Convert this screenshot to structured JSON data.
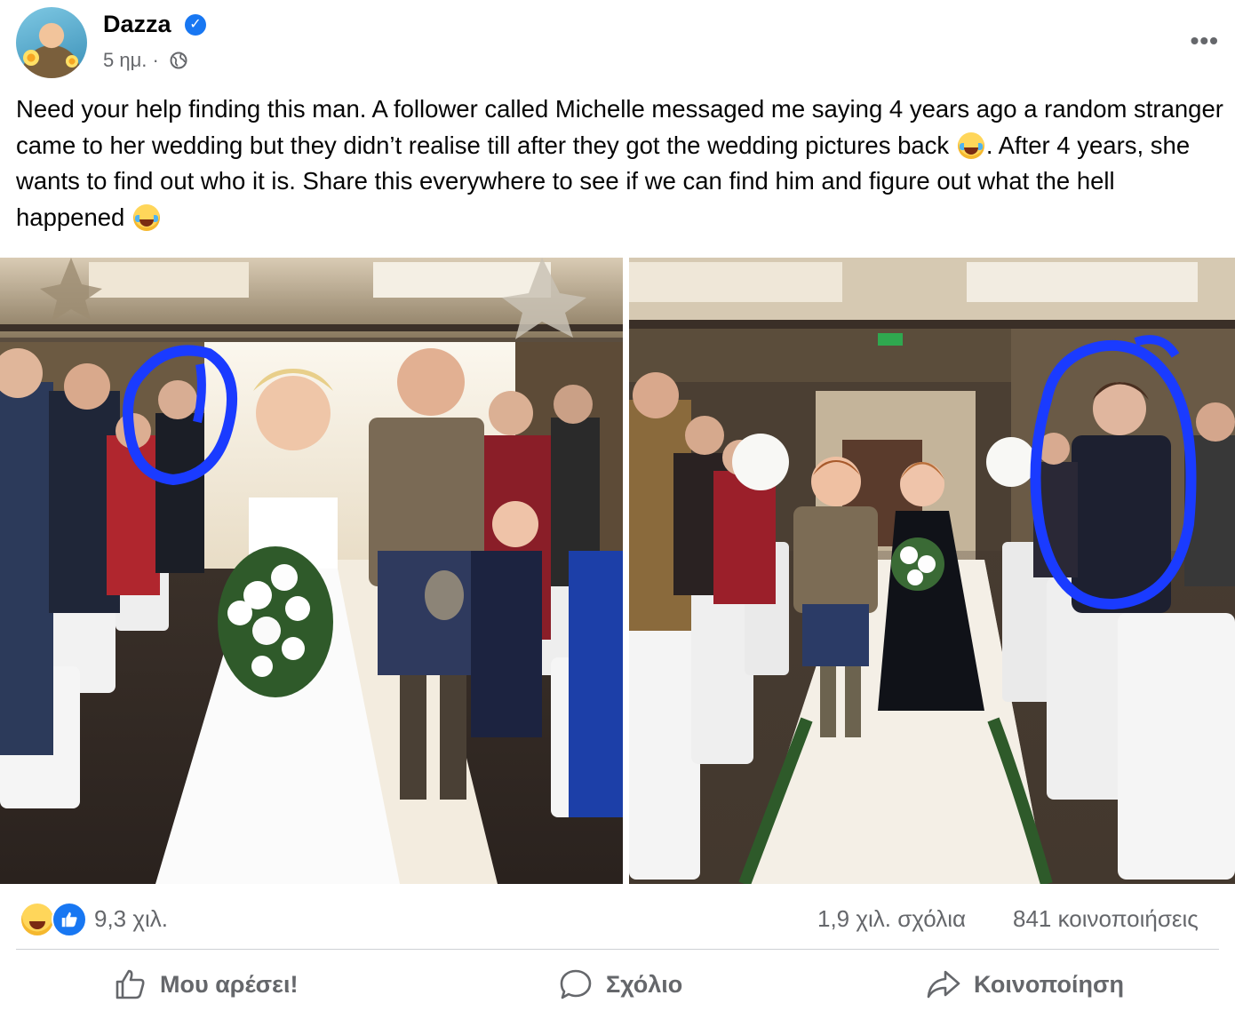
{
  "post": {
    "author": "Dazza",
    "verified_mark": "✓",
    "timestamp": "5 ημ.",
    "meta_separator": "·",
    "privacy_icon": "globe-icon",
    "more_label": "•••",
    "text_parts": [
      "Need your help finding this man. A follower called Michelle messaged me saying 4 years ago a random stranger came to her wedding but they didn’t realise till after they got the wedding pictures back ",
      ". After 4 years, she wants to find out who it is. Share this everywhere to see if we can find him and figure out what the hell happened "
    ]
  },
  "stats": {
    "reactions": [
      "haha-reaction-icon",
      "like-reaction-icon"
    ],
    "reaction_count": "9,3 χιλ.",
    "comments": "1,9 χιλ. σχόλια",
    "shares": "841 κοινοποιήσεις"
  },
  "actions": {
    "like": "Μου αρέσει!",
    "comment": "Σχόλιο",
    "share": "Κοινοποίηση"
  },
  "colors": {
    "accent": "#1877f2",
    "secondary_text": "#65676b",
    "circle_annotation": "#1a3bff"
  }
}
